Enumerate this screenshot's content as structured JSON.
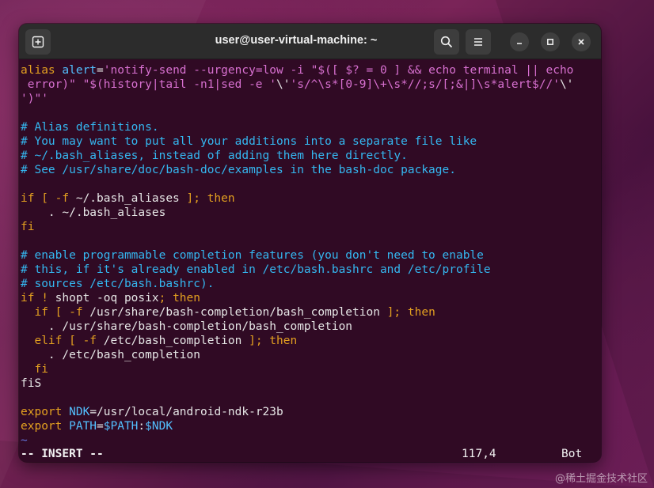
{
  "window": {
    "title": "user@user-virtual-machine: ~"
  },
  "icons": {
    "new_tab": "new-tab-icon",
    "search": "search-icon",
    "menu": "hamburger-menu-icon",
    "minimize": "minimize-icon",
    "maximize": "maximize-icon",
    "close": "close-icon"
  },
  "colors": {
    "terminal_bg": "#300a24",
    "comment": "#34b7f0",
    "keyword": "#e3a020",
    "variable": "#53c0ff",
    "string": "#d770d0",
    "tilde": "#6272d8"
  },
  "editor": {
    "lines": [
      [
        {
          "t": "alias ",
          "c": "kw"
        },
        {
          "t": "alert",
          "c": "var"
        },
        {
          "t": "=",
          "c": ""
        },
        {
          "t": "'notify-send --urgency=low -i \"$([ $? = 0 ] && echo terminal || echo",
          "c": "str"
        }
      ],
      [
        {
          "t": " error)\" \"$(history|tail -n1|sed -e '",
          "c": "str"
        },
        {
          "t": "\\'",
          "c": ""
        },
        {
          "t": "'s/^\\s*[0-9]\\+\\s*//;s/[;&|]\\s*alert$//'",
          "c": "str"
        },
        {
          "t": "\\'",
          "c": ""
        }
      ],
      [
        {
          "t": "')\"'",
          "c": "str"
        }
      ],
      [],
      [
        {
          "t": "# Alias definitions.",
          "c": "comment"
        }
      ],
      [
        {
          "t": "# You may want to put all your additions into a separate file like",
          "c": "comment"
        }
      ],
      [
        {
          "t": "# ~/.bash_aliases, instead of adding them here directly.",
          "c": "comment"
        }
      ],
      [
        {
          "t": "# See /usr/share/doc/bash-doc/examples in the bash-doc package.",
          "c": "comment"
        }
      ],
      [],
      [
        {
          "t": "if [ -f",
          "c": "kw"
        },
        {
          "t": " ~/.bash_aliases ",
          "c": ""
        },
        {
          "t": "]; then",
          "c": "kw"
        }
      ],
      [
        {
          "t": "    . ~/.bash_aliases",
          "c": ""
        }
      ],
      [
        {
          "t": "fi",
          "c": "kw"
        }
      ],
      [],
      [
        {
          "t": "# enable programmable completion features (you don't need to enable",
          "c": "comment"
        }
      ],
      [
        {
          "t": "# this, if it's already enabled in /etc/bash.bashrc and /etc/profile",
          "c": "comment"
        }
      ],
      [
        {
          "t": "# sources /etc/bash.bashrc).",
          "c": "comment"
        }
      ],
      [
        {
          "t": "if !",
          "c": "kw"
        },
        {
          "t": " shopt -oq posix",
          "c": ""
        },
        {
          "t": "; then",
          "c": "kw"
        }
      ],
      [
        {
          "t": "  if [ -f",
          "c": "kw"
        },
        {
          "t": " /usr/share/bash-completion/bash_completion ",
          "c": ""
        },
        {
          "t": "]; then",
          "c": "kw"
        }
      ],
      [
        {
          "t": "    . /usr/share/bash-completion/bash_completion",
          "c": ""
        }
      ],
      [
        {
          "t": "  elif [ -f",
          "c": "kw"
        },
        {
          "t": " /etc/bash_completion ",
          "c": ""
        },
        {
          "t": "]; then",
          "c": "kw"
        }
      ],
      [
        {
          "t": "    . /etc/bash_completion",
          "c": ""
        }
      ],
      [
        {
          "t": "  fi",
          "c": "kw"
        }
      ],
      [
        {
          "t": "fiS",
          "c": ""
        }
      ],
      [],
      [
        {
          "t": "export ",
          "c": "kw"
        },
        {
          "t": "NDK",
          "c": "var"
        },
        {
          "t": "=/usr/local/android-ndk-r23b",
          "c": ""
        }
      ],
      [
        {
          "t": "export ",
          "c": "kw"
        },
        {
          "t": "PATH",
          "c": "var"
        },
        {
          "t": "=",
          "c": ""
        },
        {
          "t": "$PATH",
          "c": "var"
        },
        {
          "t": ":",
          "c": ""
        },
        {
          "t": "$NDK",
          "c": "var"
        }
      ],
      [
        {
          "t": "~",
          "c": "tilde"
        }
      ]
    ],
    "status": {
      "mode": "-- INSERT --",
      "position": "117,4",
      "scroll": "Bot"
    }
  },
  "watermark": "@稀土掘金技术社区"
}
